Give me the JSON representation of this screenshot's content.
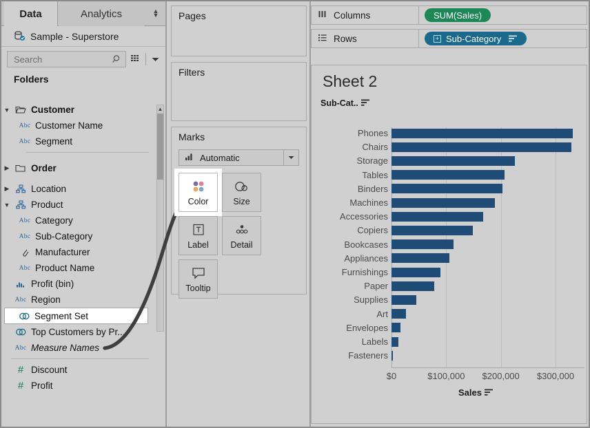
{
  "window": {
    "tabs": [
      {
        "label": "Data",
        "active": true
      },
      {
        "label": "Analytics",
        "active": false
      }
    ],
    "datasource": "Sample - Superstore"
  },
  "search": {
    "placeholder": "Search",
    "value": "",
    "icons": [
      "search-icon",
      "grid-view-icon",
      "chevron-down-icon"
    ]
  },
  "sidebar": {
    "section_header": "Folders",
    "items": [
      {
        "label": "Customer",
        "icon": "folder-open-icon",
        "type": "folder",
        "expanded": true,
        "indent": 0,
        "bold": true,
        "selected": false
      },
      {
        "label": "Customer Name",
        "icon": "abc-icon",
        "type": "field",
        "indent": 1,
        "selected": false
      },
      {
        "label": "Segment",
        "icon": "abc-icon",
        "type": "field",
        "indent": 1,
        "selected": false
      },
      {
        "label": "Order",
        "icon": "folder-icon",
        "type": "folder",
        "expanded": false,
        "indent": 0,
        "bold": true,
        "selected": false
      },
      {
        "label": "Location",
        "icon": "hierarchy-icon",
        "type": "hierarchy",
        "expanded": false,
        "indent": 0,
        "selected": false
      },
      {
        "label": "Product",
        "icon": "hierarchy-icon",
        "type": "hierarchy",
        "expanded": true,
        "indent": 0,
        "selected": false
      },
      {
        "label": "Category",
        "icon": "abc-icon",
        "type": "field",
        "indent": 1,
        "selected": false
      },
      {
        "label": "Sub-Category",
        "icon": "abc-icon",
        "type": "field",
        "indent": 1,
        "selected": false
      },
      {
        "label": "Manufacturer",
        "icon": "paperclip-icon",
        "type": "field",
        "indent": 1,
        "selected": false
      },
      {
        "label": "Product Name",
        "icon": "abc-icon",
        "type": "field",
        "indent": 1,
        "selected": false
      },
      {
        "label": "Profit (bin)",
        "icon": "bin-icon",
        "type": "field",
        "indent": 0,
        "selected": false
      },
      {
        "label": "Region",
        "icon": "abc-icon",
        "type": "field",
        "indent": 0,
        "selected": false
      },
      {
        "label": "Segment Set",
        "icon": "set-icon",
        "type": "set",
        "indent": 0,
        "selected": true
      },
      {
        "label": "Top Customers by Pr...",
        "icon": "set-icon",
        "type": "set",
        "indent": 0,
        "selected": false
      },
      {
        "label": "Measure Names",
        "icon": "abc-icon",
        "type": "field",
        "indent": 0,
        "italic": true,
        "selected": false
      },
      {
        "label": "Discount",
        "icon": "number-icon",
        "type": "measure",
        "indent": 0,
        "selected": false
      },
      {
        "label": "Profit",
        "icon": "number-icon",
        "type": "measure",
        "indent": 0,
        "selected": false
      }
    ]
  },
  "shelves": {
    "pages": {
      "title": "Pages"
    },
    "filters": {
      "title": "Filters"
    },
    "marks": {
      "title": "Marks",
      "mark_type": "Automatic",
      "mark_type_icon": "bar-mark-icon",
      "buttons": [
        {
          "label": "Color",
          "icon": "color-dots-icon",
          "highlighted": true
        },
        {
          "label": "Size",
          "icon": "size-circles-icon",
          "highlighted": false
        },
        {
          "label": "Label",
          "icon": "label-t-icon",
          "highlighted": false
        },
        {
          "label": "Detail",
          "icon": "detail-dots-icon",
          "highlighted": false
        },
        {
          "label": "Tooltip",
          "icon": "tooltip-icon",
          "highlighted": false
        }
      ]
    },
    "columns": {
      "label": "Columns",
      "icon": "columns-icon",
      "pill": {
        "text": "SUM(Sales)",
        "color": "#1d8755"
      }
    },
    "rows": {
      "label": "Rows",
      "icon": "rows-icon",
      "pill": {
        "text": "Sub-Category",
        "color": "#1b6a8c",
        "has_expand": true,
        "has_sort": true
      }
    }
  },
  "viz": {
    "title": "Sheet 2",
    "row_header": "Sub-Cat..",
    "row_header_sort_icon": "sort-descending-icon",
    "axis_title": "Sales",
    "axis_title_sort_icon": "sort-descending-icon"
  },
  "chart_data": {
    "type": "bar",
    "title": "Sheet 2",
    "orientation": "horizontal",
    "xlabel": "Sales",
    "ylabel": "Sub-Cat..",
    "xlim": [
      0,
      340000
    ],
    "ticks": [
      "$0",
      "$100,000",
      "$200,000",
      "$300,000"
    ],
    "tick_values": [
      0,
      100000,
      200000,
      300000
    ],
    "grid": true,
    "legend": "none",
    "bar_color": "#1f4b77",
    "categories": [
      "Phones",
      "Chairs",
      "Storage",
      "Tables",
      "Binders",
      "Machines",
      "Accessories",
      "Copiers",
      "Bookcases",
      "Appliances",
      "Furnishings",
      "Paper",
      "Supplies",
      "Art",
      "Envelopes",
      "Labels",
      "Fasteners"
    ],
    "values": [
      331000,
      329000,
      225000,
      207000,
      203000,
      189000,
      168000,
      149000,
      114000,
      106000,
      90000,
      78000,
      46000,
      26000,
      16000,
      12000,
      3000
    ]
  },
  "annotation": {
    "type": "arrow",
    "from": "sidebar-item-segment-set",
    "to": "marks-color-button",
    "color": "#3f3f3f"
  }
}
